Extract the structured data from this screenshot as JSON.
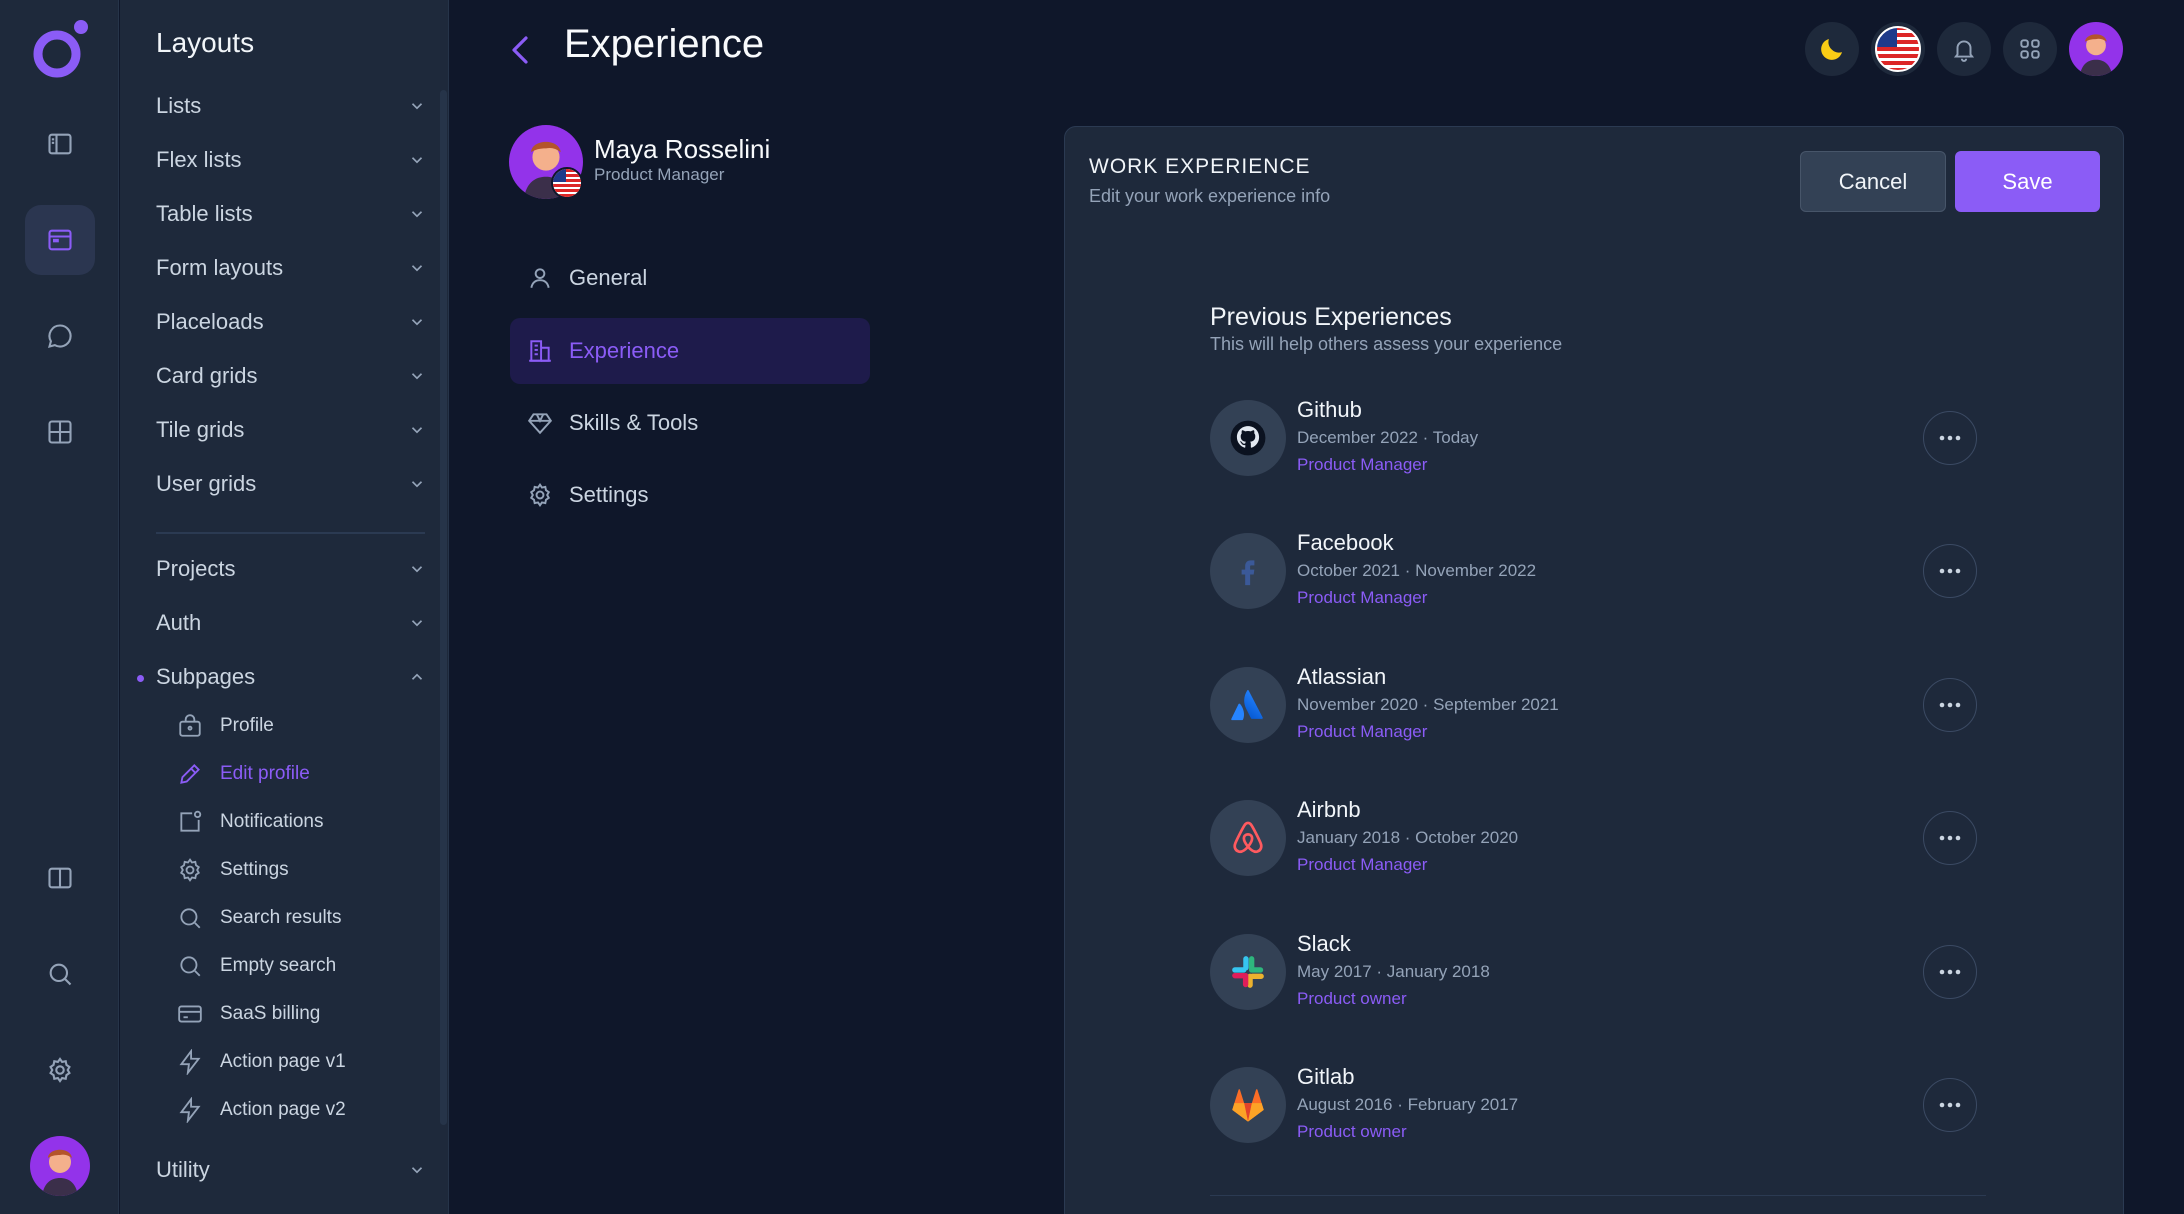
{
  "menu": {
    "title": "Layouts",
    "items": [
      "Lists",
      "Flex lists",
      "Table lists",
      "Form layouts",
      "Placeloads",
      "Card grids",
      "Tile grids",
      "User grids"
    ],
    "items2": [
      "Projects",
      "Auth"
    ],
    "subpages": {
      "label": "Subpages",
      "children": [
        "Profile",
        "Edit profile",
        "Notifications",
        "Settings",
        "Search results",
        "Empty search",
        "SaaS billing",
        "Action page v1",
        "Action page v2"
      ],
      "active": "Edit profile"
    },
    "utility": "Utility"
  },
  "header": {
    "title": "Experience"
  },
  "profile": {
    "name": "Maya Rosselini",
    "role": "Product Manager"
  },
  "tabs": [
    "General",
    "Experience",
    "Skills & Tools",
    "Settings"
  ],
  "active_tab": "Experience",
  "card": {
    "title": "WORK EXPERIENCE",
    "subtitle": "Edit your work experience info",
    "cancel": "Cancel",
    "save": "Save"
  },
  "section": {
    "title": "Previous Experiences",
    "subtitle": "This will help others assess your experience"
  },
  "experiences": [
    {
      "company": "Github",
      "dates": "December 2022 · Today",
      "role": "Product Manager",
      "logo": "github-icon"
    },
    {
      "company": "Facebook",
      "dates": "October 2021 · November 2022",
      "role": "Product Manager",
      "logo": "facebook-icon"
    },
    {
      "company": "Atlassian",
      "dates": "November 2020 · September 2021",
      "role": "Product Manager",
      "logo": "atlassian-icon"
    },
    {
      "company": "Airbnb",
      "dates": "January 2018 · October 2020",
      "role": "Product Manager",
      "logo": "airbnb-icon"
    },
    {
      "company": "Slack",
      "dates": "May 2017 · January 2018",
      "role": "Product owner",
      "logo": "slack-icon"
    },
    {
      "company": "Gitlab",
      "dates": "August 2016 · February 2017",
      "role": "Product owner",
      "logo": "gitlab-icon"
    }
  ],
  "colors": {
    "background": "#0f172a",
    "panel": "#1e293b",
    "accent": "#8b5cf6",
    "text": "#e2e8f0",
    "muted": "#94a3b8"
  }
}
